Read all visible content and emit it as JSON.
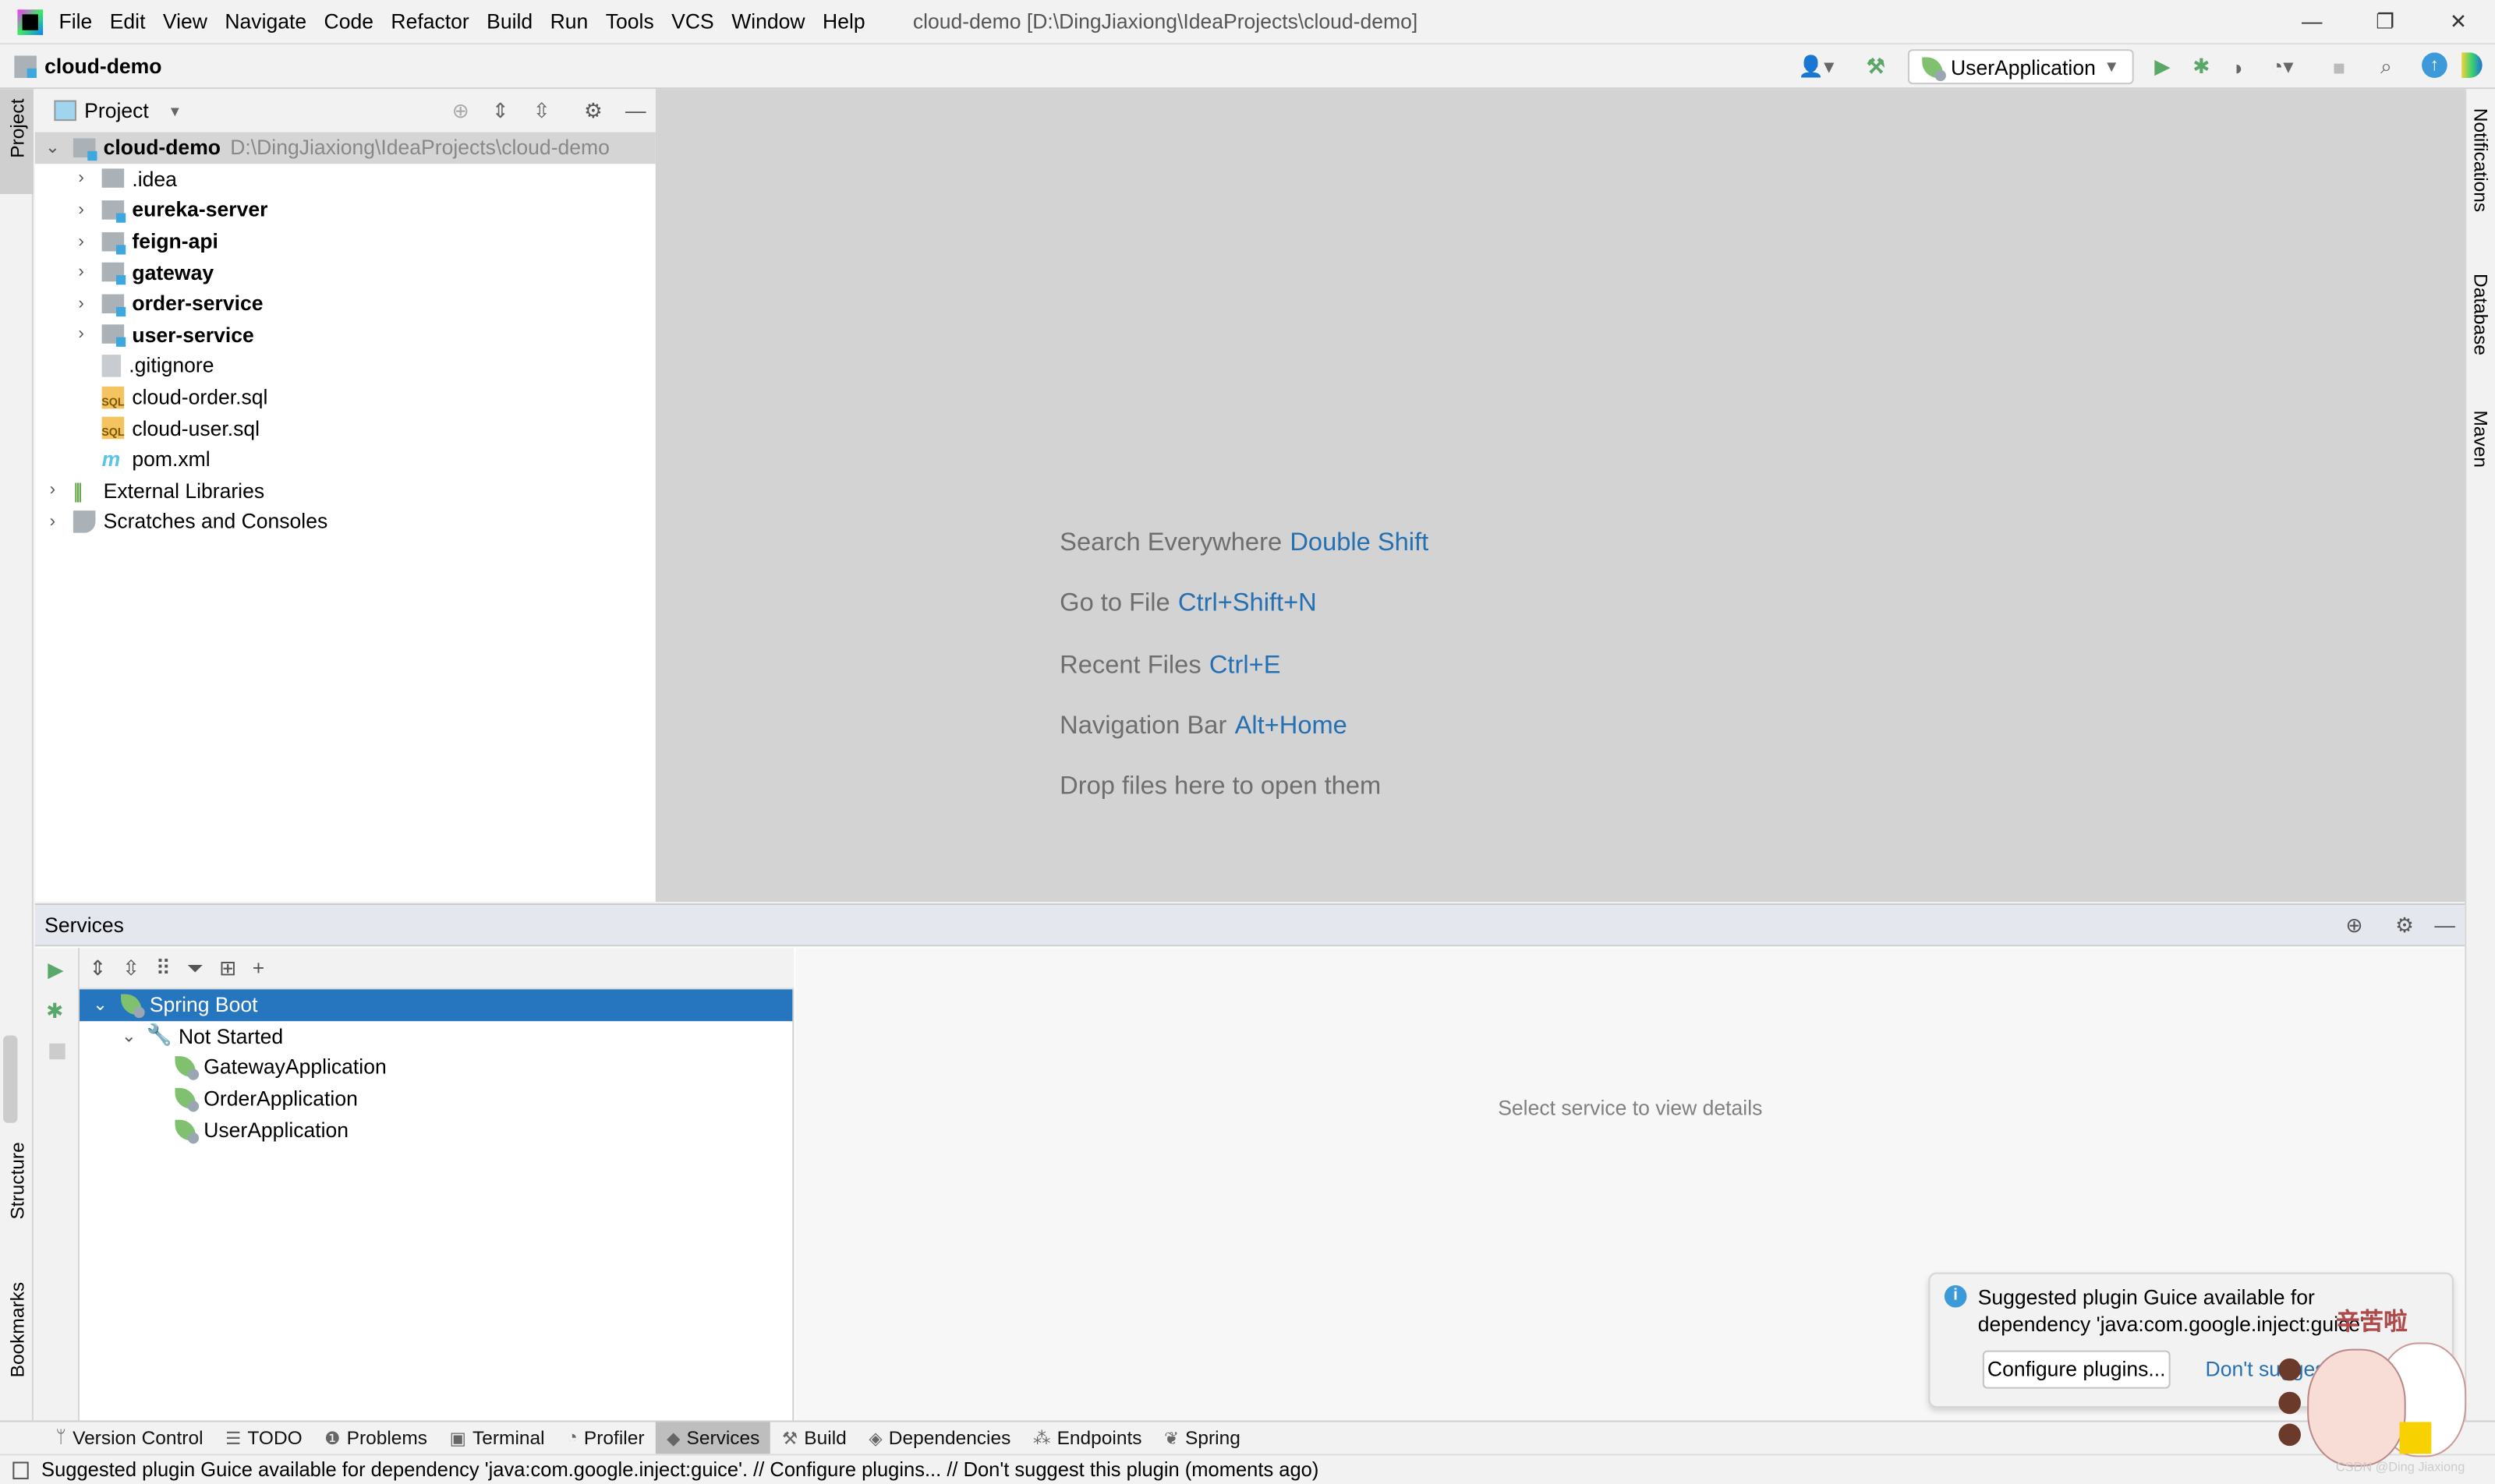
{
  "titlebar": {
    "menu": [
      "File",
      "Edit",
      "View",
      "Navigate",
      "Code",
      "Refactor",
      "Build",
      "Run",
      "Tools",
      "VCS",
      "Window",
      "Help"
    ],
    "title": "cloud-demo [D:\\DingJiaxiong\\IdeaProjects\\cloud-demo]",
    "minimize": "—",
    "restore": "❐",
    "close": "✕"
  },
  "navbar": {
    "breadcrumb": "cloud-demo",
    "run_config": "UserApplication"
  },
  "left_stripe": {
    "project": "Project",
    "structure": "Structure",
    "bookmarks": "Bookmarks"
  },
  "right_stripe": {
    "notifications": "Notifications",
    "database": "Database",
    "maven": "Maven"
  },
  "project": {
    "header": "Project",
    "root": {
      "name": "cloud-demo",
      "path": "D:\\DingJiaxiong\\IdeaProjects\\cloud-demo"
    },
    "items": [
      {
        "name": ".idea",
        "type": "folder"
      },
      {
        "name": "eureka-server",
        "type": "module"
      },
      {
        "name": "feign-api",
        "type": "module"
      },
      {
        "name": "gateway",
        "type": "module"
      },
      {
        "name": "order-service",
        "type": "module"
      },
      {
        "name": "user-service",
        "type": "module"
      },
      {
        "name": ".gitignore",
        "type": "file"
      },
      {
        "name": "cloud-order.sql",
        "type": "sql"
      },
      {
        "name": "cloud-user.sql",
        "type": "sql"
      },
      {
        "name": "pom.xml",
        "type": "maven"
      }
    ],
    "external_libraries": "External Libraries",
    "scratches": "Scratches and Consoles"
  },
  "editor": {
    "hints": [
      {
        "text": "Search Everywhere",
        "key": "Double Shift"
      },
      {
        "text": "Go to File",
        "key": "Ctrl+Shift+N"
      },
      {
        "text": "Recent Files",
        "key": "Ctrl+E"
      },
      {
        "text": "Navigation Bar",
        "key": "Alt+Home"
      },
      {
        "text": "Drop files here to open them",
        "key": ""
      }
    ]
  },
  "services": {
    "title": "Services",
    "root": "Spring Boot",
    "group": "Not Started",
    "apps": [
      "GatewayApplication",
      "OrderApplication",
      "UserApplication"
    ],
    "empty": "Select service to view details"
  },
  "bottom_tabs": [
    {
      "label": "Version Control",
      "icon": "branch-icon"
    },
    {
      "label": "TODO",
      "icon": "list-icon"
    },
    {
      "label": "Problems",
      "icon": "problems-icon"
    },
    {
      "label": "Terminal",
      "icon": "terminal-icon"
    },
    {
      "label": "Profiler",
      "icon": "profiler-icon"
    },
    {
      "label": "Services",
      "icon": "services-icon",
      "active": true
    },
    {
      "label": "Build",
      "icon": "hammer-icon"
    },
    {
      "label": "Dependencies",
      "icon": "dependencies-icon"
    },
    {
      "label": "Endpoints",
      "icon": "endpoints-icon"
    },
    {
      "label": "Spring",
      "icon": "spring-icon"
    }
  ],
  "notification": {
    "line1": "Suggested plugin Guice available for",
    "line2": "dependency 'java:com.google.inject:guice'.",
    "configure": "Configure plugins...",
    "dont_suggest": "Don't suggest",
    "sticker_text": "辛苦啦",
    "watermark": "CSDN @Ding Jiaxiong"
  },
  "status": {
    "message": "Suggested plugin Guice available for dependency 'java:com.google.inject:guice'. // Configure plugins... // Don't suggest this plugin (moments ago)"
  },
  "colors": {
    "selection": "#2675bf",
    "link": "#2470b3",
    "run_green": "#59a869",
    "editor_bg": "#d3d3d3"
  }
}
